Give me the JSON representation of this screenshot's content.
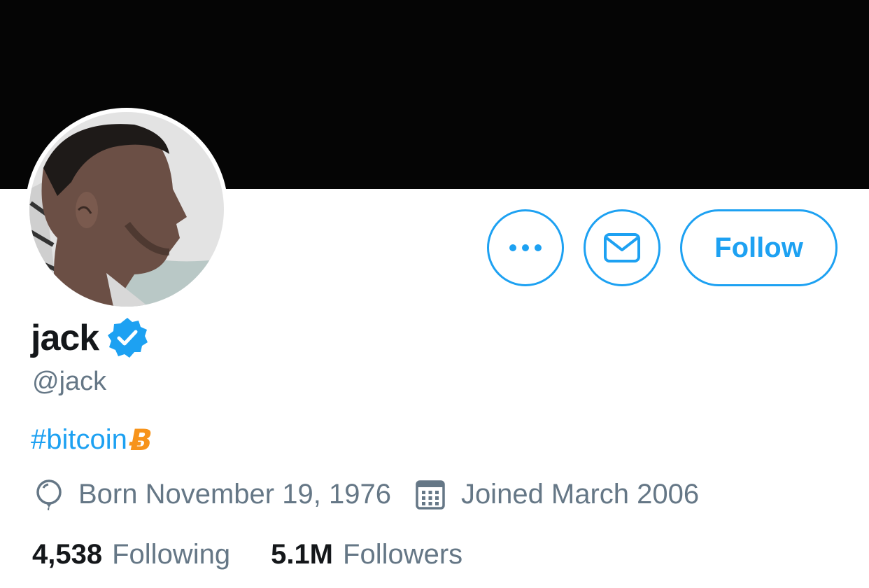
{
  "profile": {
    "name": "jack",
    "handle": "@jack",
    "verified": true,
    "bio": {
      "hashtag": "#bitcoin",
      "emoji": "Ƀ"
    },
    "born": "Born November 19, 1976",
    "joined": "Joined March 2006"
  },
  "actions": {
    "more_icon": "more-dots-icon",
    "message_icon": "envelope-icon",
    "follow_label": "Follow"
  },
  "stats": {
    "following_count": "4,538",
    "following_label": "Following",
    "followers_count": "5.1M",
    "followers_label": "Followers"
  },
  "colors": {
    "accent": "#1da1f2",
    "text_primary": "#14171a",
    "text_secondary": "#657786",
    "bitcoin": "#f7931a",
    "banner": "#050505"
  }
}
